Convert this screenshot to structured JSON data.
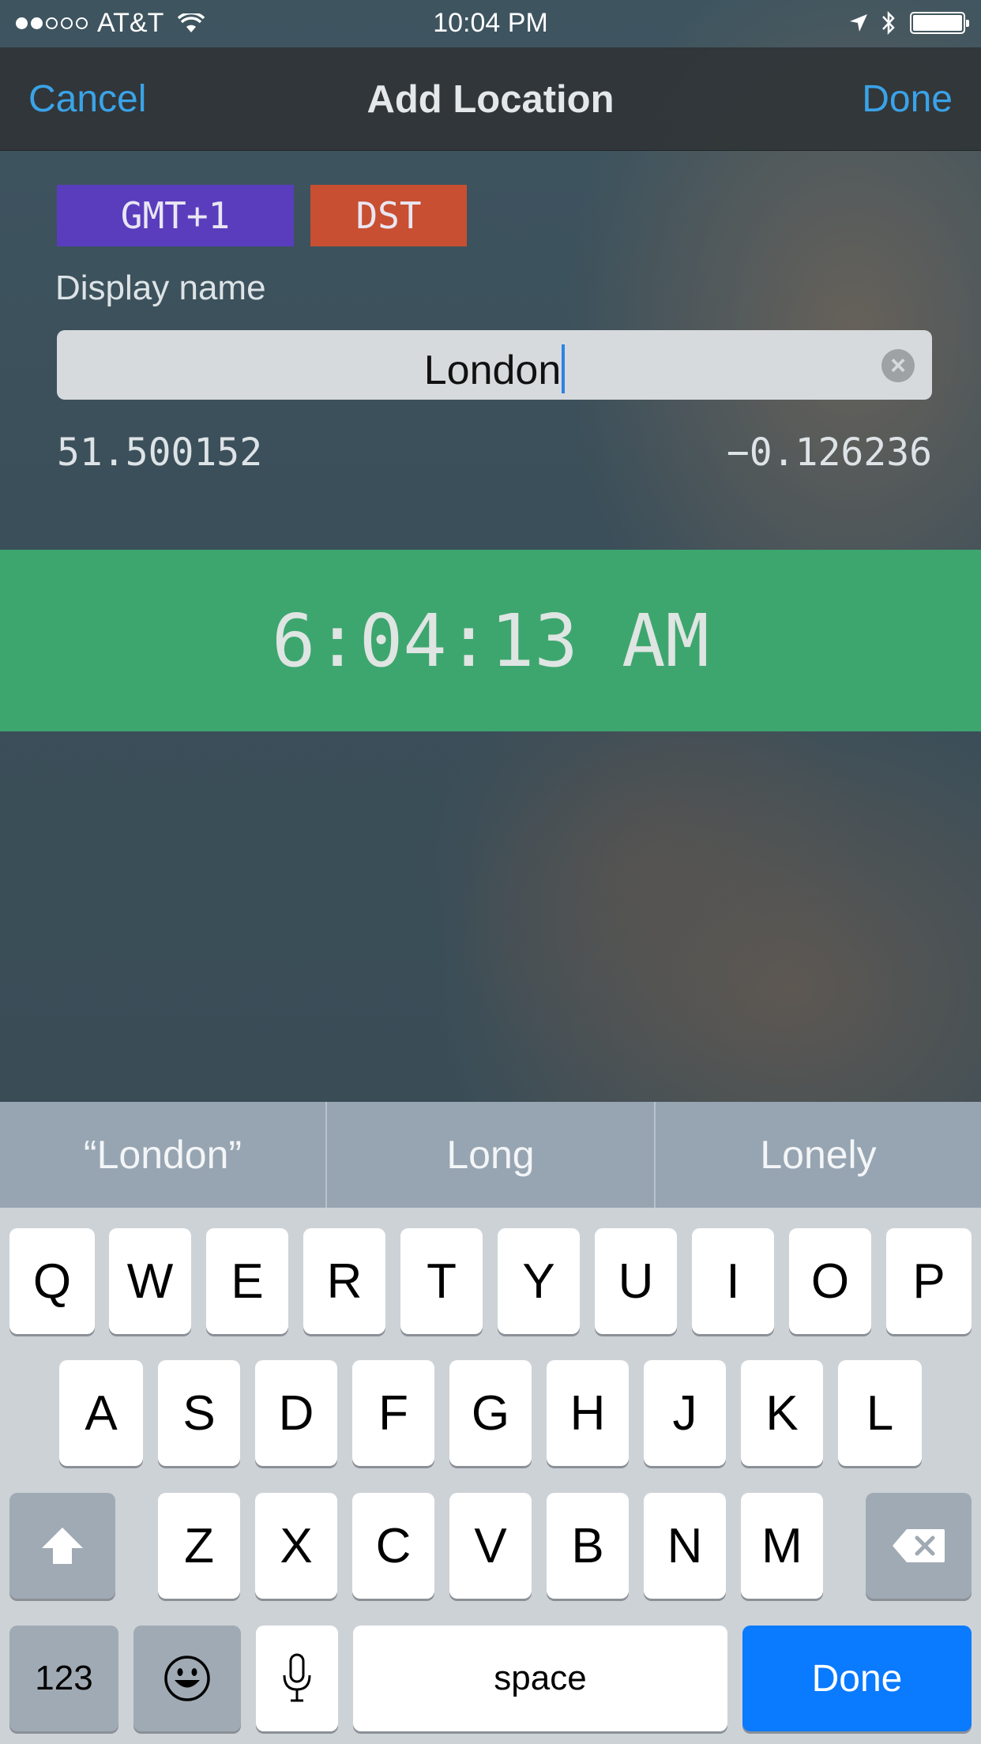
{
  "status_bar": {
    "carrier": "AT&T",
    "time": "10:04 PM",
    "signal_bars_filled": 2,
    "signal_bars_total": 5
  },
  "nav": {
    "cancel": "Cancel",
    "title": "Add Location",
    "done": "Done"
  },
  "tags": {
    "gmt": "GMT+1",
    "dst": "DST",
    "colors": {
      "gmt": "#5a3dbd",
      "dst": "#c84f31"
    }
  },
  "form": {
    "display_name_label": "Display name",
    "display_name_value": "London",
    "latitude": "51.500152",
    "longitude": "−0.126236"
  },
  "clock": {
    "time": "6:04:13 AM",
    "color": "#3da66e"
  },
  "keyboard": {
    "suggestions": [
      "“London”",
      "Long",
      "Lonely"
    ],
    "row1": [
      "Q",
      "W",
      "E",
      "R",
      "T",
      "Y",
      "U",
      "I",
      "O",
      "P"
    ],
    "row2": [
      "A",
      "S",
      "D",
      "F",
      "G",
      "H",
      "J",
      "K",
      "L"
    ],
    "row3": [
      "Z",
      "X",
      "C",
      "V",
      "B",
      "N",
      "M"
    ],
    "numbers_key": "123",
    "space_key": "space",
    "done_key": "Done",
    "done_color": "#0a7aff"
  }
}
